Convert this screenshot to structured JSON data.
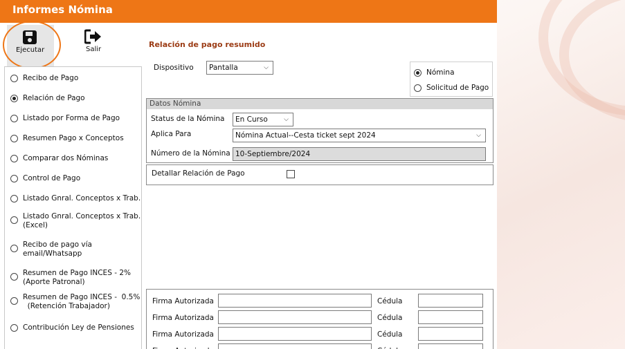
{
  "window": {
    "title": "Informes Nómina"
  },
  "toolbar": {
    "execute_label": "Ejecutar",
    "exit_label": "Salir"
  },
  "report_options": [
    {
      "label": "Recibo de Pago",
      "selected": false
    },
    {
      "label": "Relación de Pago",
      "selected": true
    },
    {
      "label": "Listado por Forma de Pago",
      "selected": false
    },
    {
      "label": "Resumen Pago x Conceptos",
      "selected": false
    },
    {
      "label": "Comparar dos Nóminas",
      "selected": false
    },
    {
      "label": "Control de Pago",
      "selected": false
    },
    {
      "label": "Listado Gnral. Conceptos x Trab.",
      "selected": false
    },
    {
      "label": "Listado Gnral. Conceptos x Trab.",
      "label2": "(Excel)",
      "selected": false
    },
    {
      "label": "Recibo de pago vía",
      "label2": "email/Whatsapp",
      "selected": false
    },
    {
      "label": "Resumen de Pago INCES -  2%",
      "label2": "(Aporte Patronal)",
      "selected": false
    },
    {
      "label": "Resumen de Pago INCES -  0.5%",
      "label2": "  (Retención Trabajador)",
      "selected": false
    },
    {
      "label": "Contribución Ley de Pensiones",
      "selected": false
    }
  ],
  "main": {
    "section_title": "Relación de pago resumido",
    "device_label": "Dispositivo",
    "device_value": "Pantalla",
    "type_options": [
      {
        "label": "Nómina",
        "selected": true
      },
      {
        "label": "Solicitud de Pago",
        "selected": false
      }
    ],
    "datos": {
      "header": "Datos Nómina",
      "status_label": "Status de la Nómina",
      "status_value": "En Curso",
      "aplica_label": "Aplica Para",
      "aplica_value": "Nómina Actual--Cesta ticket sept 2024",
      "numero_label": "Número de la  Nómina",
      "numero_value": "10-Septiembre/2024"
    },
    "detail_label": "Detallar Relación de Pago",
    "detail_checked": false,
    "signatures": {
      "firma_label": "Firma Autorizada",
      "cedula_label": "Cédula"
    }
  }
}
